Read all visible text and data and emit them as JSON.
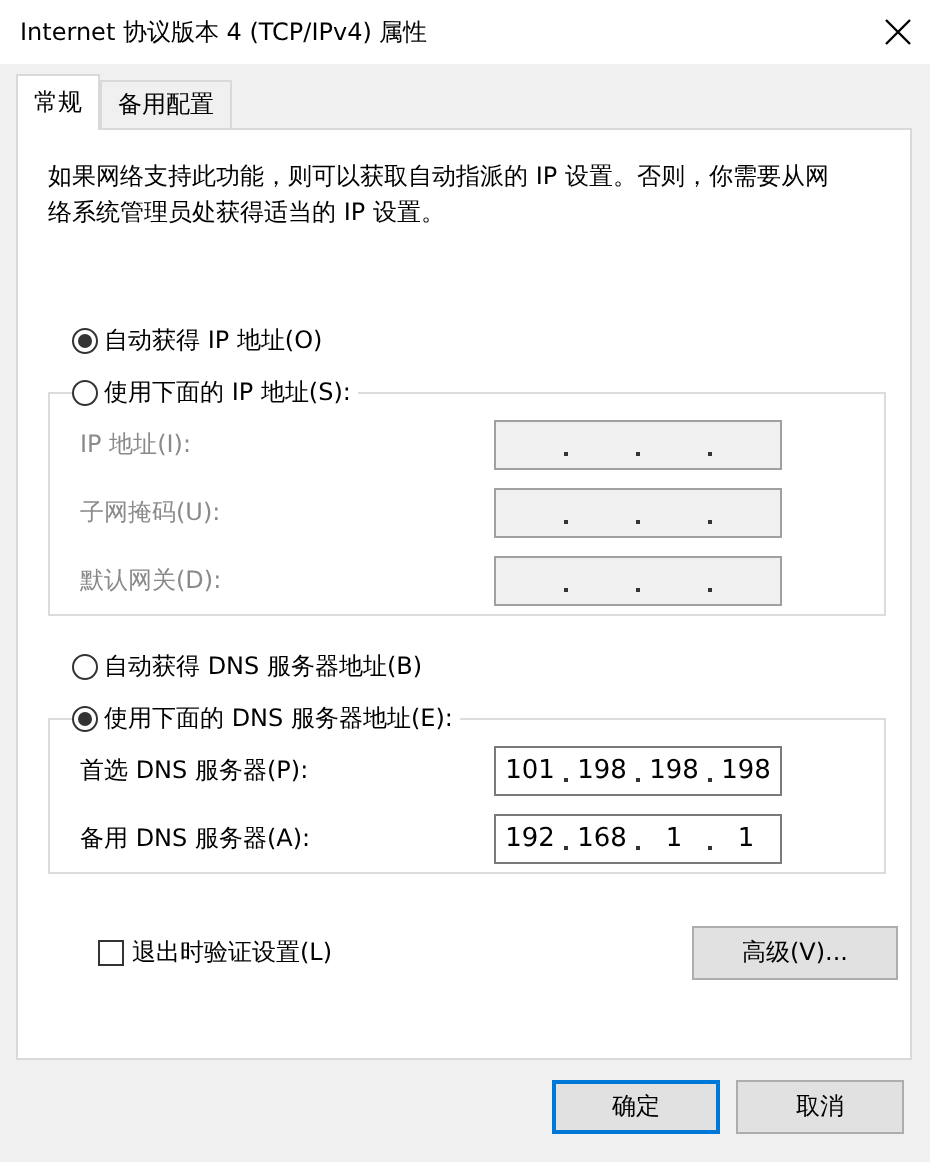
{
  "window": {
    "title": "Internet 协议版本 4 (TCP/IPv4) 属性"
  },
  "tabs": [
    {
      "label": "常规",
      "selected": true
    },
    {
      "label": "备用配置",
      "selected": false
    }
  ],
  "description": "如果网络支持此功能，则可以获取自动指派的 IP 设置。否则，你需要从网络系统管理员处获得适当的 IP 设置。",
  "ip_options": [
    {
      "label": "自动获得 IP 地址(O)",
      "selected": true
    },
    {
      "label": "使用下面的 IP 地址(S):",
      "selected": false
    }
  ],
  "ip_fields": [
    {
      "label": "IP 地址(I):",
      "disabled": true
    },
    {
      "label": "子网掩码(U):",
      "disabled": true
    },
    {
      "label": "默认网关(D):",
      "disabled": true
    }
  ],
  "dns_options": [
    {
      "label": "自动获得 DNS 服务器地址(B)",
      "selected": false
    },
    {
      "label": "使用下面的 DNS 服务器地址(E):",
      "selected": true
    }
  ],
  "dns_fields": [
    {
      "label": "首选 DNS 服务器(P):",
      "disabled": false,
      "octets": [
        "101",
        "198",
        "198",
        "198"
      ]
    },
    {
      "label": "备用 DNS 服务器(A):",
      "disabled": false,
      "octets": [
        "192",
        "168",
        "1",
        "1"
      ]
    }
  ],
  "validate_on_exit": {
    "label": "退出时验证设置(L)",
    "checked": false
  },
  "advanced_button": "高级(V)...",
  "buttons": [
    {
      "label": "确定",
      "kind": "default"
    },
    {
      "label": "取消",
      "kind": "normal"
    }
  ]
}
